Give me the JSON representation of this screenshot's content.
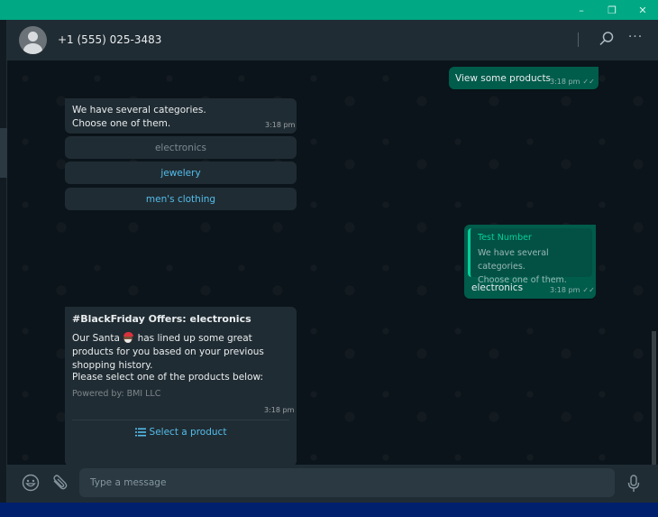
{
  "window": {
    "controls": {
      "minimize": "–",
      "maximize": "❐",
      "close": "✕"
    },
    "accent_color": "#00a884"
  },
  "header": {
    "contact_name": "+1 (555) 025-3483",
    "icons": [
      "avatar-placeholder",
      "search-icon",
      "more-options-icon"
    ],
    "menu_label": "···"
  },
  "messages": [
    {
      "direction": "outgoing",
      "text": "View some products",
      "time": "3:18 pm",
      "status": "read"
    },
    {
      "direction": "incoming",
      "text_lines": [
        "We have several categories.",
        "Choose one of them."
      ],
      "time": "3:18 pm",
      "quick_replies": [
        {
          "label": "electronics",
          "state": "used"
        },
        {
          "label": "jewelery",
          "state": "active"
        },
        {
          "label": "men's clothing",
          "state": "active"
        }
      ]
    },
    {
      "direction": "outgoing",
      "quote": {
        "author": "Test Number",
        "lines": [
          "We have several categories.",
          "Choose one of them."
        ]
      },
      "text": "electronics",
      "time": "3:18 pm",
      "status": "read"
    },
    {
      "direction": "incoming",
      "title": "#BlackFriday Offers: electronics",
      "body_before_emoji": "Our Santa",
      "emoji": "santa-emoji",
      "body_after_emoji": " has lined up some great products for you based on your previous shopping history.",
      "paragraph2": "Please select one of the products below:",
      "footer": "Powered by: BMI LLC",
      "time": "3:18 pm",
      "action": {
        "icon": "list-icon",
        "label": "Select a product"
      }
    }
  ],
  "composer": {
    "placeholder": "Type a message",
    "value": "",
    "icons": [
      "emoji-icon",
      "attachment-icon",
      "microphone-icon"
    ]
  },
  "ticks": "✓✓"
}
